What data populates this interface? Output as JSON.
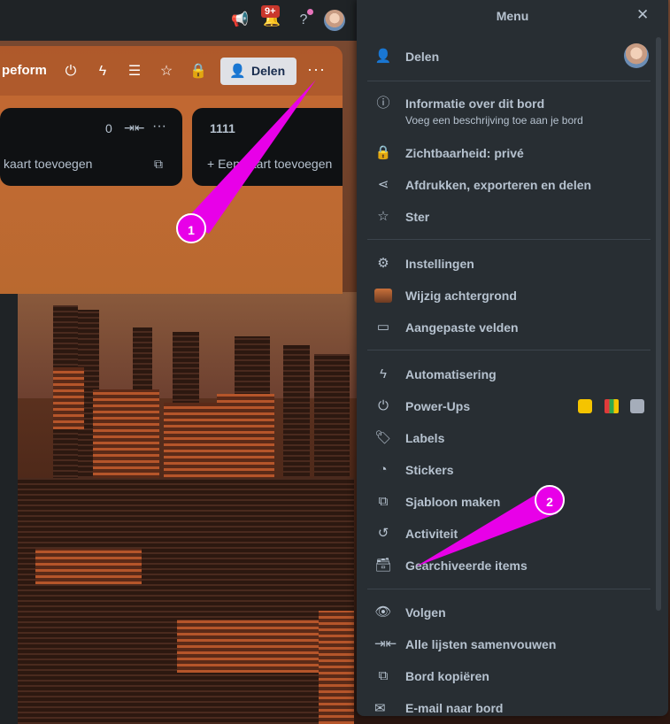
{
  "topbar": {
    "notification_count": "9+",
    "icons": [
      "megaphone-icon",
      "bell-icon",
      "help-icon",
      "avatar"
    ]
  },
  "board": {
    "title_fragment": "peform",
    "share_label": "Delen",
    "lists": [
      {
        "name": "",
        "count": "0",
        "add_label": "kaart toevoegen"
      },
      {
        "name": "1111",
        "add_label": "+ Een kaart toevoegen"
      }
    ]
  },
  "menu": {
    "title": "Menu",
    "items": [
      {
        "label": "Delen",
        "icon": "add-user-icon"
      },
      {
        "label": "Informatie over dit bord",
        "sub": "Voeg een beschrijving toe aan je bord",
        "icon": "info-icon"
      },
      {
        "label": "Zichtbaarheid: privé",
        "icon": "lock-icon"
      },
      {
        "label": "Afdrukken, exporteren en delen",
        "icon": "share-icon"
      },
      {
        "label": "Ster",
        "icon": "star-icon"
      },
      {
        "label": "Instellingen",
        "icon": "gear-icon"
      },
      {
        "label": "Wijzig achtergrond",
        "icon": "background-thumbnail"
      },
      {
        "label": "Aangepaste velden",
        "icon": "custom-fields-icon"
      },
      {
        "label": "Automatisering",
        "icon": "lightning-icon"
      },
      {
        "label": "Power-Ups",
        "icon": "plug-icon"
      },
      {
        "label": "Labels",
        "icon": "label-icon"
      },
      {
        "label": "Stickers",
        "icon": "sticker-icon"
      },
      {
        "label": "Sjabloon maken",
        "icon": "template-icon"
      },
      {
        "label": "Activiteit",
        "icon": "history-icon"
      },
      {
        "label": "Gearchiveerde items",
        "icon": "archive-icon"
      },
      {
        "label": "Volgen",
        "icon": "eye-icon"
      },
      {
        "label": "Alle lijsten samenvouwen",
        "icon": "collapse-icon"
      },
      {
        "label": "Bord kopiëren",
        "icon": "copy-icon"
      },
      {
        "label": "E-mail naar bord",
        "icon": "email-icon"
      }
    ]
  },
  "annotations": [
    {
      "label": "1"
    },
    {
      "label": "2"
    }
  ],
  "colors": {
    "annotation": "#e800e8",
    "menu_bg": "#282e33"
  }
}
